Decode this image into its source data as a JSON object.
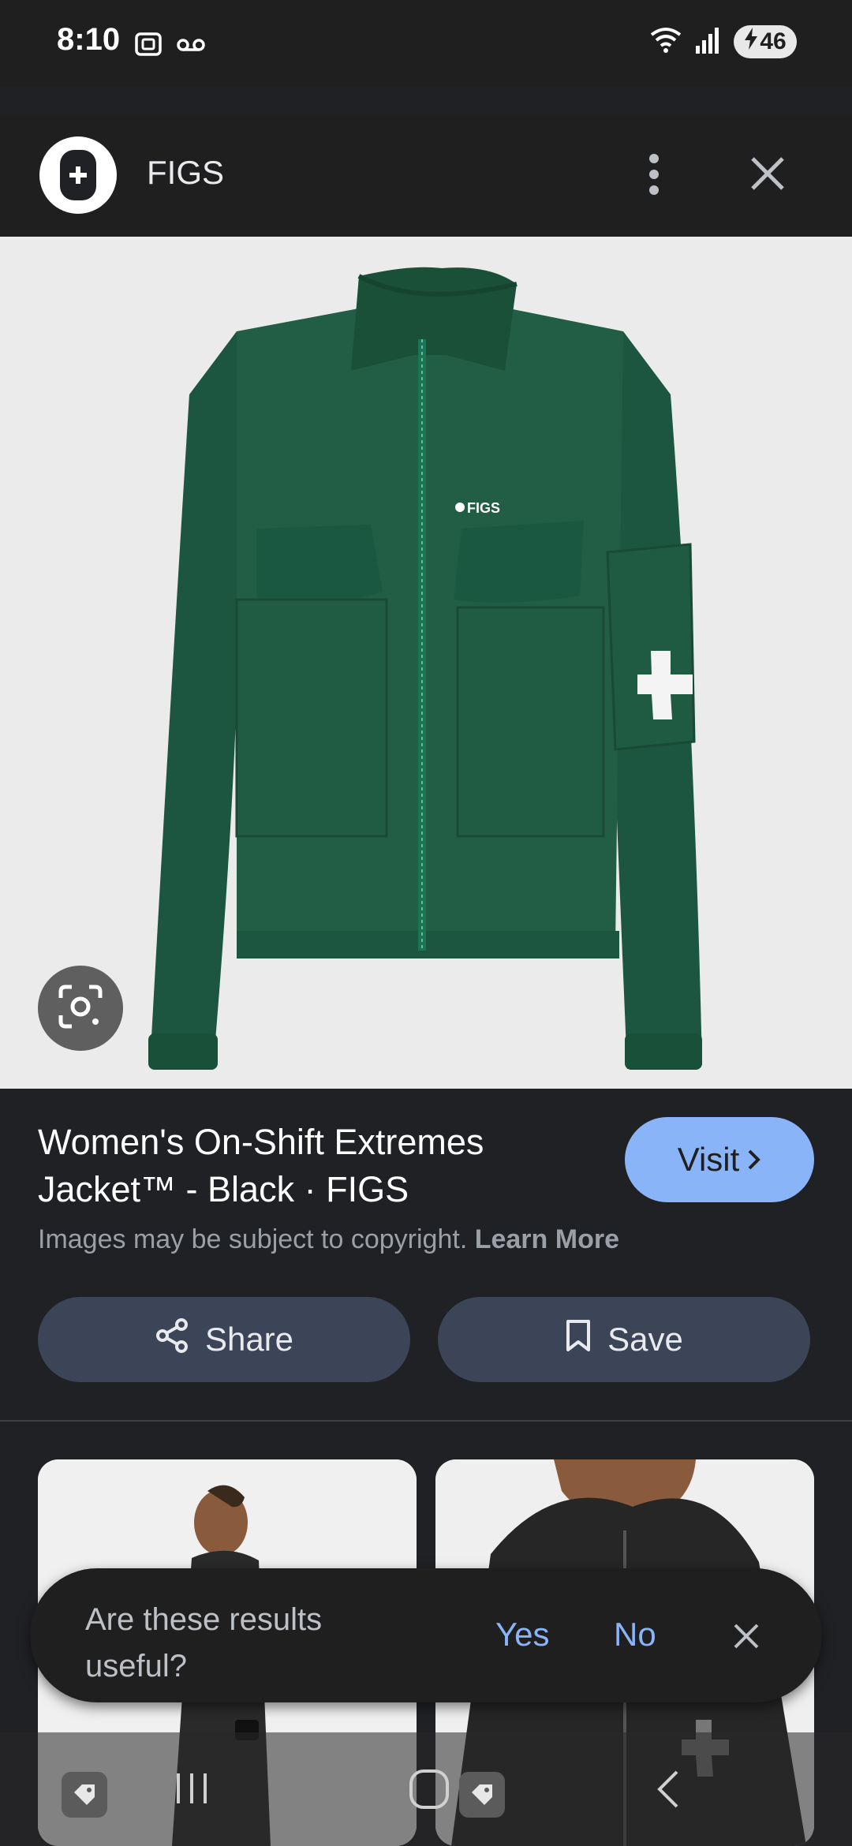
{
  "status": {
    "time": "8:10",
    "battery": "46",
    "left_icons": [
      "screenshot-icon",
      "voicemail-icon"
    ],
    "right_icons": [
      "wifi-icon",
      "signal-icon",
      "battery-charging-icon"
    ]
  },
  "header": {
    "site_name": "FIGS",
    "icons": [
      "figs-logo-icon",
      "more-vert-icon",
      "close-icon"
    ]
  },
  "hero": {
    "logo_text": "FIGS",
    "colors": {
      "jacket": "#1f5a42",
      "background": "#ebebeb"
    }
  },
  "product": {
    "title_line1": "Women's On-Shift Extremes",
    "title_line2": "Jacket™ - Black · FIGS",
    "visit_label": "Visit",
    "copyright_text": "Images may be subject to copyright.",
    "learn_more": "Learn More"
  },
  "actions": {
    "share_label": "Share",
    "save_label": "Save"
  },
  "feedback": {
    "question": "Are these results useful?",
    "yes": "Yes",
    "no": "No"
  },
  "colors": {
    "accent": "#8ab4f8",
    "action_button": "#3c4557",
    "background": "#202124"
  }
}
